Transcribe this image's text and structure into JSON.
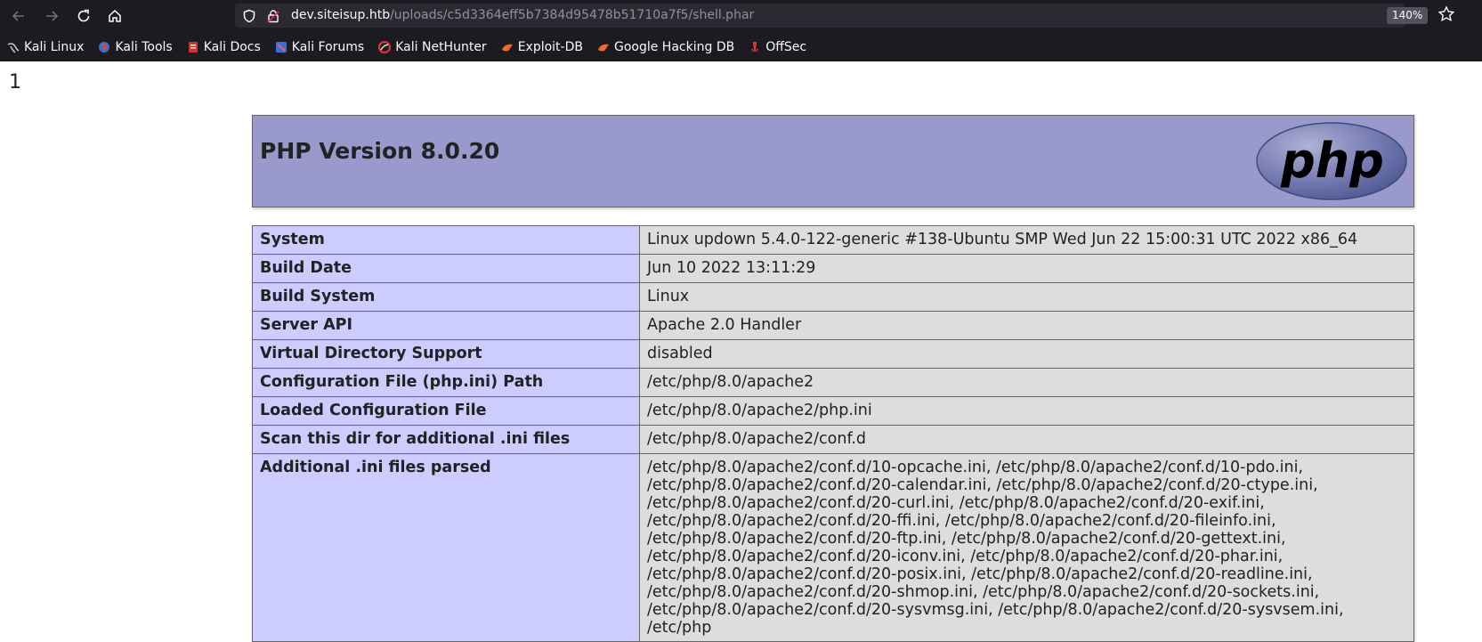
{
  "browser": {
    "url_host": "dev.siteisup.htb",
    "url_path": "/uploads/c5d3364eff5b7384d95478b51710a7f5/shell.phar",
    "zoom": "140%",
    "icons": [
      "back-icon",
      "forward-icon",
      "reload-icon",
      "home-icon",
      "shield-icon",
      "lock-icon",
      "star-icon"
    ]
  },
  "bookmarks": [
    {
      "label": "Kali Linux",
      "icon": "kali-dragon-icon"
    },
    {
      "label": "Kali Tools",
      "icon": "kali-tools-icon"
    },
    {
      "label": "Kali Docs",
      "icon": "kali-docs-icon"
    },
    {
      "label": "Kali Forums",
      "icon": "kali-forums-icon"
    },
    {
      "label": "Kali NetHunter",
      "icon": "nethunter-icon"
    },
    {
      "label": "Exploit-DB",
      "icon": "exploit-db-icon"
    },
    {
      "label": "Google Hacking DB",
      "icon": "ghdb-icon"
    },
    {
      "label": "OffSec",
      "icon": "offsec-icon"
    }
  ],
  "page": {
    "echo_output": "1",
    "title": "PHP Version 8.0.20",
    "logo_text": "php",
    "rows": [
      {
        "key": "System",
        "value": "Linux updown 5.4.0-122-generic #138-Ubuntu SMP Wed Jun 22 15:00:31 UTC 2022 x86_64"
      },
      {
        "key": "Build Date",
        "value": "Jun 10 2022 13:11:29"
      },
      {
        "key": "Build System",
        "value": "Linux"
      },
      {
        "key": "Server API",
        "value": "Apache 2.0 Handler"
      },
      {
        "key": "Virtual Directory Support",
        "value": "disabled"
      },
      {
        "key": "Configuration File (php.ini) Path",
        "value": "/etc/php/8.0/apache2"
      },
      {
        "key": "Loaded Configuration File",
        "value": "/etc/php/8.0/apache2/php.ini"
      },
      {
        "key": "Scan this dir for additional .ini files",
        "value": "/etc/php/8.0/apache2/conf.d"
      },
      {
        "key": "Additional .ini files parsed",
        "value": "/etc/php/8.0/apache2/conf.d/10-opcache.ini, /etc/php/8.0/apache2/conf.d/10-pdo.ini, /etc/php/8.0/apache2/conf.d/20-calendar.ini, /etc/php/8.0/apache2/conf.d/20-ctype.ini, /etc/php/8.0/apache2/conf.d/20-curl.ini, /etc/php/8.0/apache2/conf.d/20-exif.ini, /etc/php/8.0/apache2/conf.d/20-ffi.ini, /etc/php/8.0/apache2/conf.d/20-fileinfo.ini, /etc/php/8.0/apache2/conf.d/20-ftp.ini, /etc/php/8.0/apache2/conf.d/20-gettext.ini, /etc/php/8.0/apache2/conf.d/20-iconv.ini, /etc/php/8.0/apache2/conf.d/20-phar.ini, /etc/php/8.0/apache2/conf.d/20-posix.ini, /etc/php/8.0/apache2/conf.d/20-readline.ini, /etc/php/8.0/apache2/conf.d/20-shmop.ini, /etc/php/8.0/apache2/conf.d/20-sockets.ini, /etc/php/8.0/apache2/conf.d/20-sysvmsg.ini, /etc/php/8.0/apache2/conf.d/20-sysvsem.ini, /etc/php"
      }
    ]
  }
}
